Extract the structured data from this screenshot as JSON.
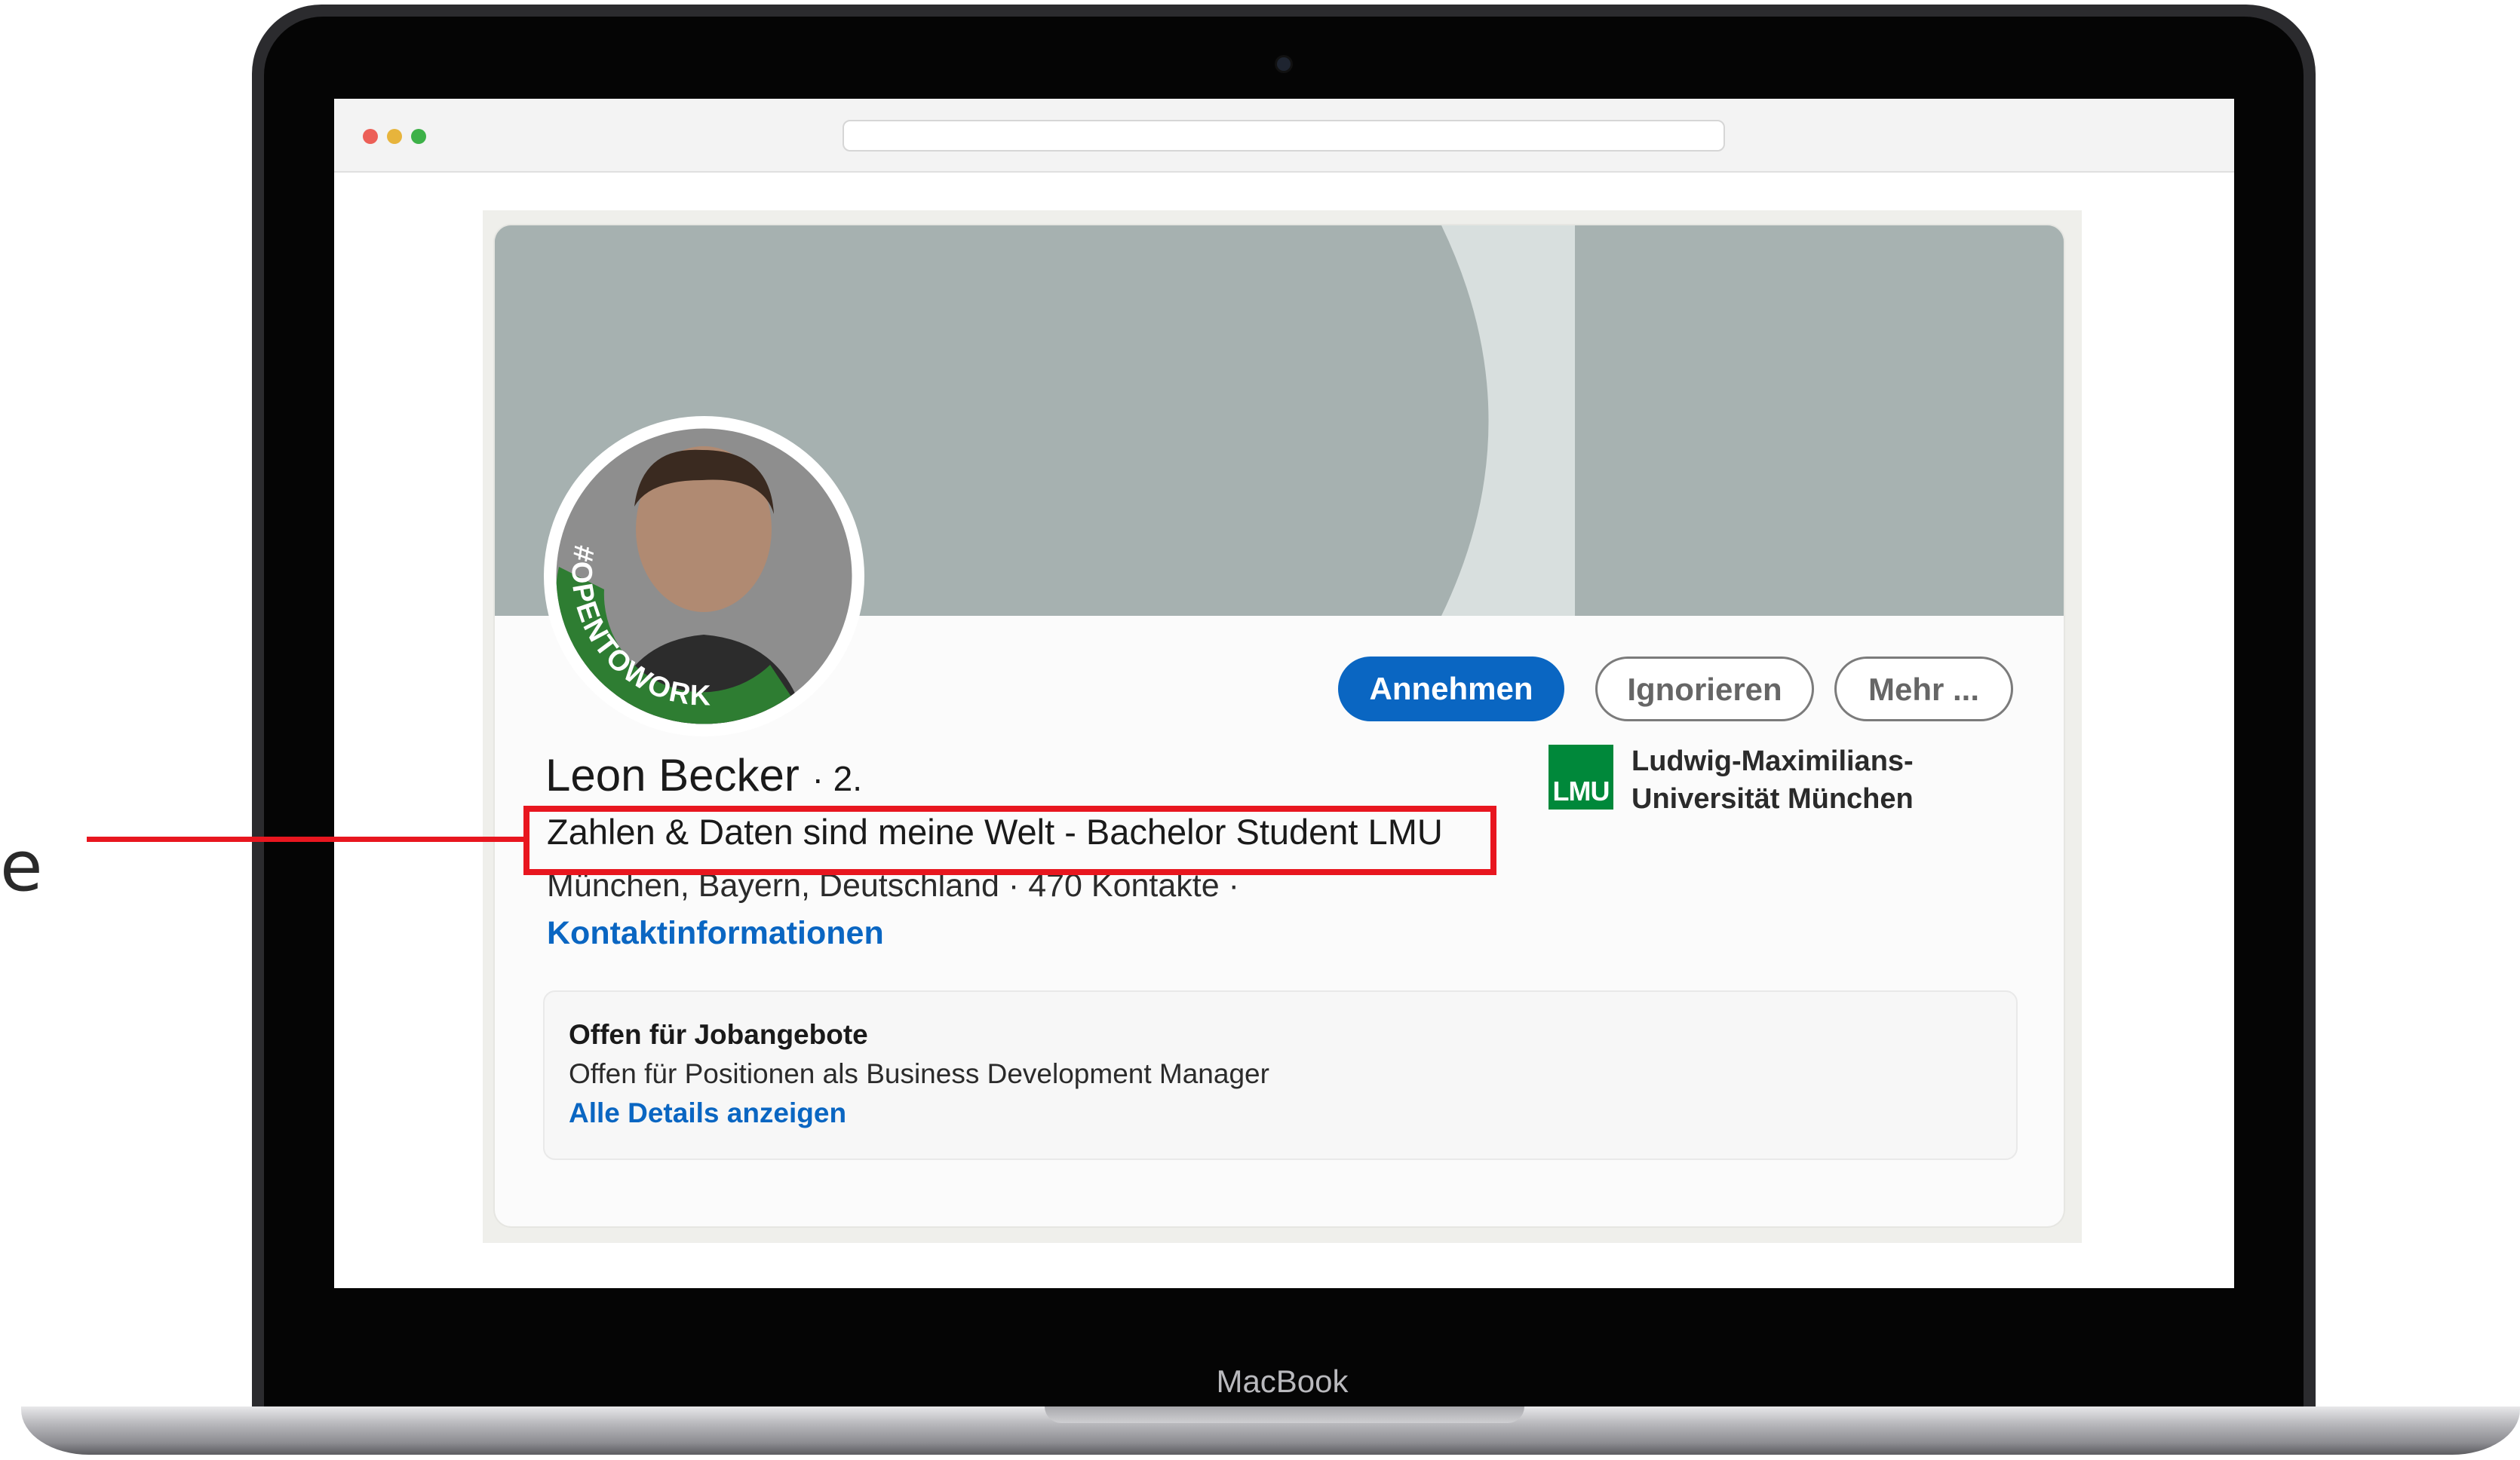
{
  "device": {
    "brand_label": "MacBook"
  },
  "profile": {
    "name": "Leon Becker",
    "connection_degree": "· 2.",
    "headline": "Zahlen & Daten sind meine Welt - Bachelor Student LMU",
    "location": "München, Bayern, Deutschland",
    "separator": "·",
    "connections": "470 Kontakte",
    "trailing_separator": "·",
    "contact_info_link": "Kontaktinformationen",
    "avatar_frame_text": "#OPENTOWORK"
  },
  "actions": {
    "accept_label": "Annehmen",
    "ignore_label": "Ignorieren",
    "more_label": "Mehr ..."
  },
  "education": {
    "logo_text": "LMU",
    "name": "Ludwig-Maximilians-Universität München"
  },
  "open_to_work": {
    "title": "Offen für Jobangebote",
    "description": "Offen für Positionen als Business Development Manager",
    "details_link": "Alle Details anzeigen"
  },
  "annotation": {
    "side_glyph": "e",
    "color": "#e8161f"
  },
  "colors": {
    "primary": "#0a66c2",
    "otw_green": "#2e7d32",
    "lmu_green": "#00883a",
    "cover": "#a5b0b0"
  }
}
